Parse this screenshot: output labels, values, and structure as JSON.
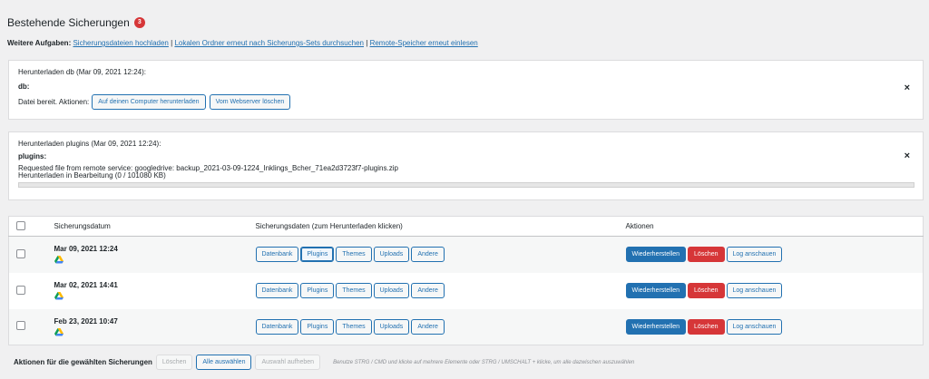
{
  "header": {
    "title": "Bestehende Sicherungen",
    "count": "3"
  },
  "tasks": {
    "label": "Weitere Aufgaben:",
    "links": [
      "Sicherungsdateien hochladen",
      "Lokalen Ordner erneut nach Sicherungs-Sets durchsuchen",
      "Remote-Speicher erneut einlesen"
    ],
    "separator": "|"
  },
  "panel_db": {
    "title": "Herunterladen db (Mar 09, 2021 12:24):",
    "key": "db:",
    "actions_label": "Datei bereit. Aktionen:",
    "download_button": "Auf deinen Computer herunterladen",
    "delete_button": "Vom Webserver löschen",
    "close": "×"
  },
  "panel_plugins": {
    "title": "Herunterladen plugins (Mar 09, 2021 12:24):",
    "key": "plugins:",
    "line1": "Requested file from remote service: googledrive: backup_2021-03-09-1224_Inklings_Bcher_71ea2d3723f7-plugins.zip",
    "line2": "Herunterladen in Bearbeitung (0 / 101080 KB)",
    "progress": 0,
    "close": "×"
  },
  "table": {
    "headers": {
      "date": "Sicherungsdatum",
      "data": "Sicherungsdaten (zum Herunterladen klicken)",
      "actions": "Aktionen"
    },
    "data_buttons": [
      "Datenbank",
      "Plugins",
      "Themes",
      "Uploads",
      "Andere"
    ],
    "action_buttons": {
      "restore": "Wiederherstellen",
      "delete": "Löschen",
      "log": "Log anschauen"
    },
    "rows": [
      {
        "date": "Mar 09, 2021 12:24",
        "storage_icon": "google-drive-icon"
      },
      {
        "date": "Mar 02, 2021 14:41",
        "storage_icon": "google-drive-icon"
      },
      {
        "date": "Feb 23, 2021 10:47",
        "storage_icon": "google-drive-icon"
      }
    ]
  },
  "bulk": {
    "label": "Aktionen für die gewählten Sicherungen",
    "delete": "Löschen",
    "select_all": "Alle auswählen",
    "deselect": "Auswahl aufheben",
    "hint": "Benutze STRG / CMD und klicke auf mehrere Elemente oder STRG / UMSCHALT + klicke, um alle dazwischen auszuwählen"
  },
  "colors": {
    "primary": "#2271b1",
    "danger": "#d63638",
    "badge": "#d63638"
  }
}
